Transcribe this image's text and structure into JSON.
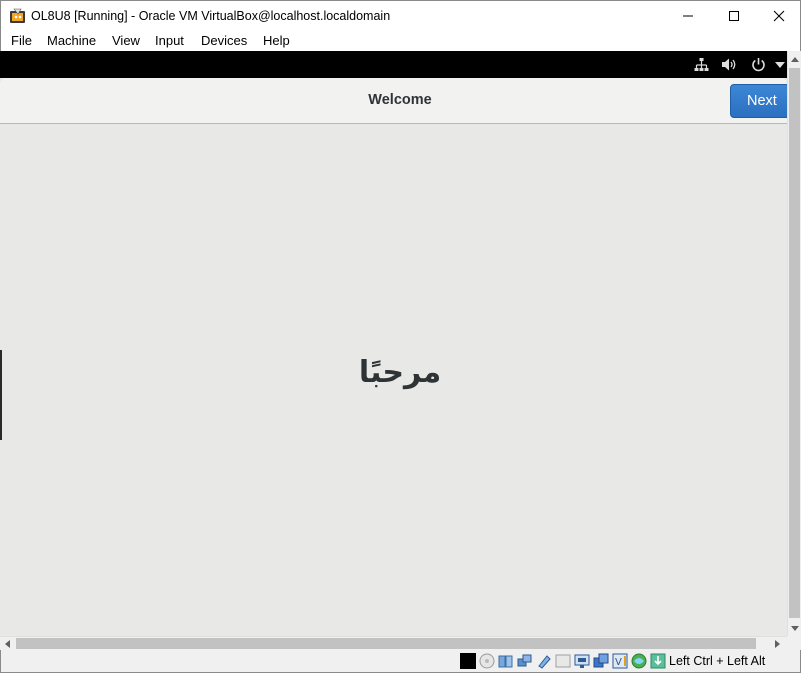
{
  "window": {
    "title": "OL8U8 [Running] - Oracle VM VirtualBox@localhost.localdomain"
  },
  "menu": {
    "items": [
      "File",
      "Machine",
      "View",
      "Input",
      "Devices",
      "Help"
    ]
  },
  "gnome_panel": {
    "icons": [
      "network-icon",
      "volume-icon",
      "power-icon",
      "chevron-down-icon"
    ]
  },
  "installer": {
    "header_title": "Welcome",
    "next_label": "Next",
    "welcome_text": "مرحبًا"
  },
  "statusbar": {
    "host_key": "Left Ctrl + Left Alt",
    "icons": [
      "display-recording-icon",
      "optical-drive-icon",
      "audio-icon",
      "network-adapter-icon",
      "usb-icon",
      "shared-folders-icon",
      "display-icon",
      "capture-icon",
      "cpu-icon",
      "guest-additions-icon",
      "mouse-integration-icon",
      "keyboard-icon"
    ]
  },
  "colors": {
    "accent": "#2c70c0",
    "installer_bg": "#e8e8e7",
    "header_bg": "#f2f2f1",
    "panel_bg": "#000000"
  }
}
